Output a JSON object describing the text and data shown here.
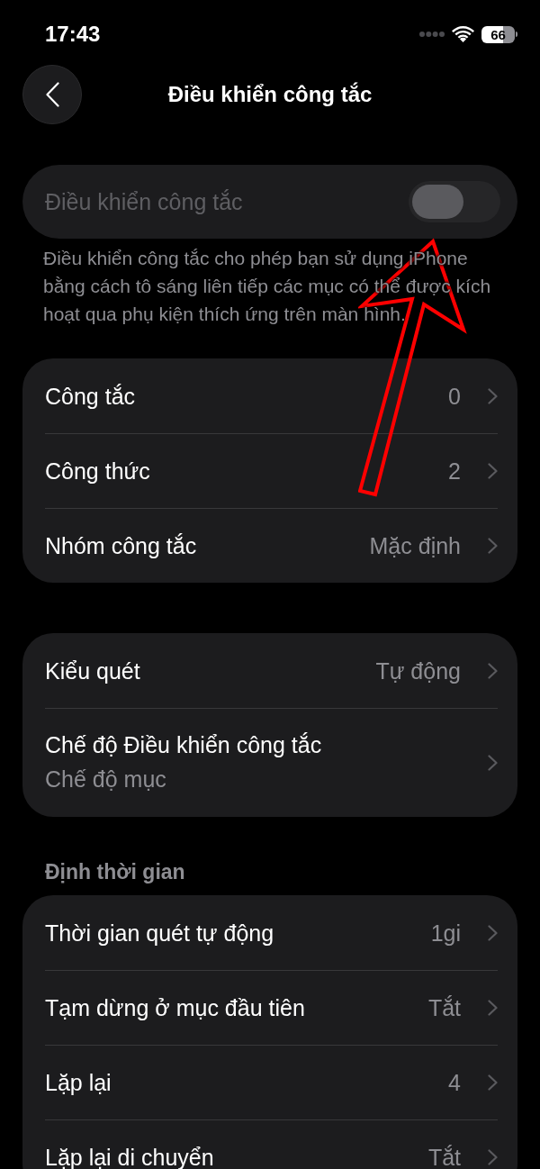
{
  "status_bar": {
    "time": "17:43",
    "battery": "66"
  },
  "nav": {
    "title": "Điều khiển công tắc"
  },
  "toggle": {
    "label": "Điều khiển công tắc",
    "on": false,
    "disabled": true
  },
  "description": "Điều khiển công tắc cho phép bạn sử dụng iPhone bằng cách tô sáng liên tiếp các mục có thể được kích hoạt qua phụ kiện thích ứng trên màn hình.",
  "groups": [
    {
      "rows": [
        {
          "label": "Công tắc",
          "value": "0"
        },
        {
          "label": "Công thức",
          "value": "2"
        },
        {
          "label": "Nhóm công tắc",
          "value": "Mặc định"
        }
      ]
    },
    {
      "rows": [
        {
          "label": "Kiểu quét",
          "value": "Tự động"
        },
        {
          "label": "Chế độ Điều khiển công tắc",
          "subtitle": "Chế độ mục"
        }
      ]
    },
    {
      "header": "Định thời gian",
      "rows": [
        {
          "label": "Thời gian quét tự động",
          "value": "1gi"
        },
        {
          "label": "Tạm dừng ở mục đầu tiên",
          "value": "Tắt"
        },
        {
          "label": "Lặp lại",
          "value": "4"
        },
        {
          "label": "Lặp lại di chuyển",
          "value": "Tắt"
        }
      ]
    }
  ]
}
